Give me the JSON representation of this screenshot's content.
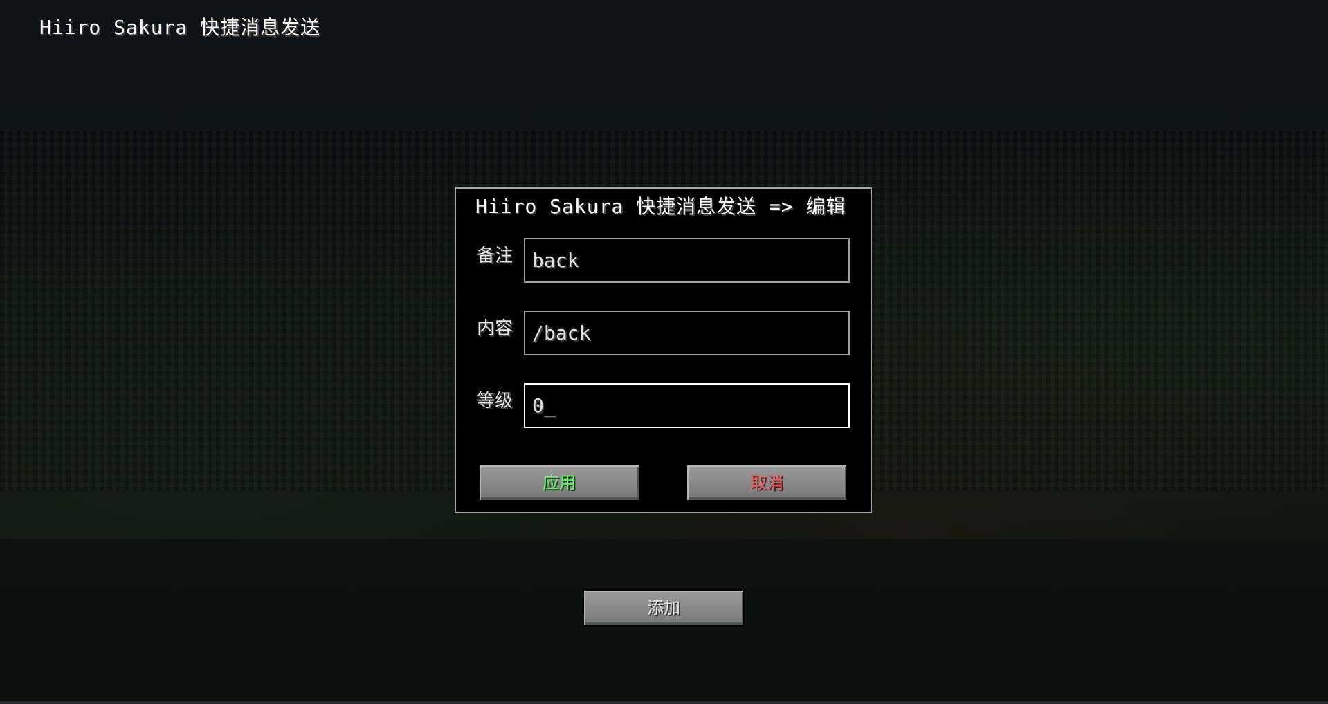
{
  "screen": {
    "title": "Hiiro Sakura 快捷消息发送"
  },
  "dialog": {
    "title": "Hiiro Sakura 快捷消息发送 => 编辑",
    "fields": [
      {
        "label": "备注",
        "value": "back"
      },
      {
        "label": "内容",
        "value": "/back"
      },
      {
        "label": "等级",
        "value": "0_"
      }
    ],
    "apply_label": "应用",
    "cancel_label": "取消"
  },
  "add_label": "添加",
  "colors": {
    "apply_text": "#55ff55",
    "cancel_text": "#ff5555",
    "title_text": "#ffffff",
    "button_face": "#8b8b8b",
    "focused_border": "#ffffff"
  }
}
